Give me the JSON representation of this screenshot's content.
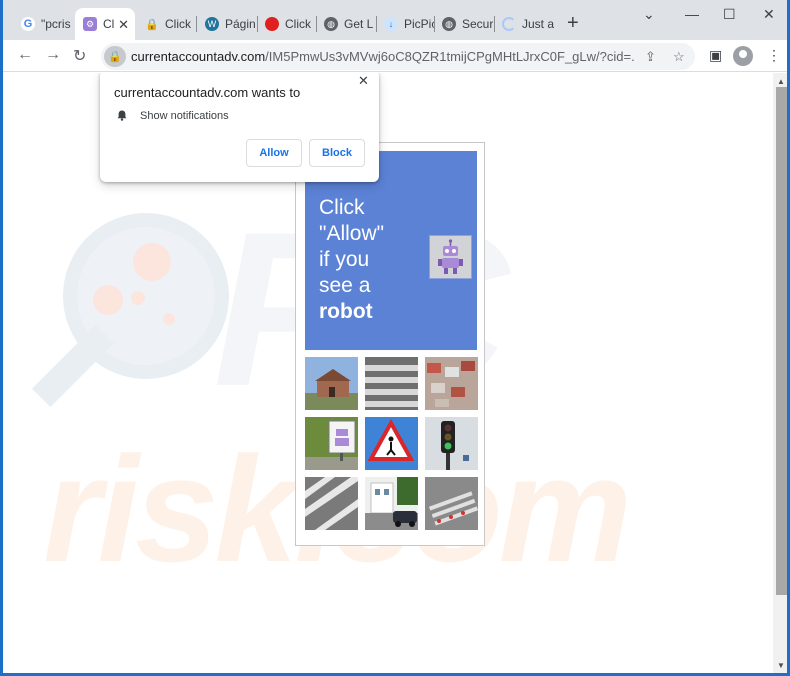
{
  "tabs": [
    {
      "label": "\"pcris",
      "icon": "google-icon"
    },
    {
      "label": "Cl",
      "icon": "robot-icon",
      "active": true
    },
    {
      "label": "Click",
      "icon": "lock-icon"
    },
    {
      "label": "Págin",
      "icon": "wordpress-icon"
    },
    {
      "label": "Click",
      "icon": "red-circle-icon"
    },
    {
      "label": "Get L",
      "icon": "globe-icon"
    },
    {
      "label": "PicPic",
      "icon": "download-icon"
    },
    {
      "label": "Secur",
      "icon": "globe-icon"
    },
    {
      "label": "Just a",
      "icon": "loading-icon"
    }
  ],
  "toolbar": {
    "url_host": "currentaccountadv.com",
    "url_rest": "/IM5PmwUs3vMVwj6oC8QZR1tmijCPgMHtLJrxC0F_gLw/?cid=..."
  },
  "permission": {
    "title": "currentaccountadv.com wants to",
    "item": "Show notifications",
    "allow": "Allow",
    "block": "Block"
  },
  "card": {
    "lines": [
      "Click",
      "\"Allow\"",
      "if you",
      "see a",
      "robot"
    ]
  },
  "watermark": {
    "brand": "PC",
    "text": "risk.com"
  },
  "colors": {
    "card_blue": "#5b82d5",
    "link_blue": "#1a73e8",
    "frame": "#1e6fc8"
  }
}
